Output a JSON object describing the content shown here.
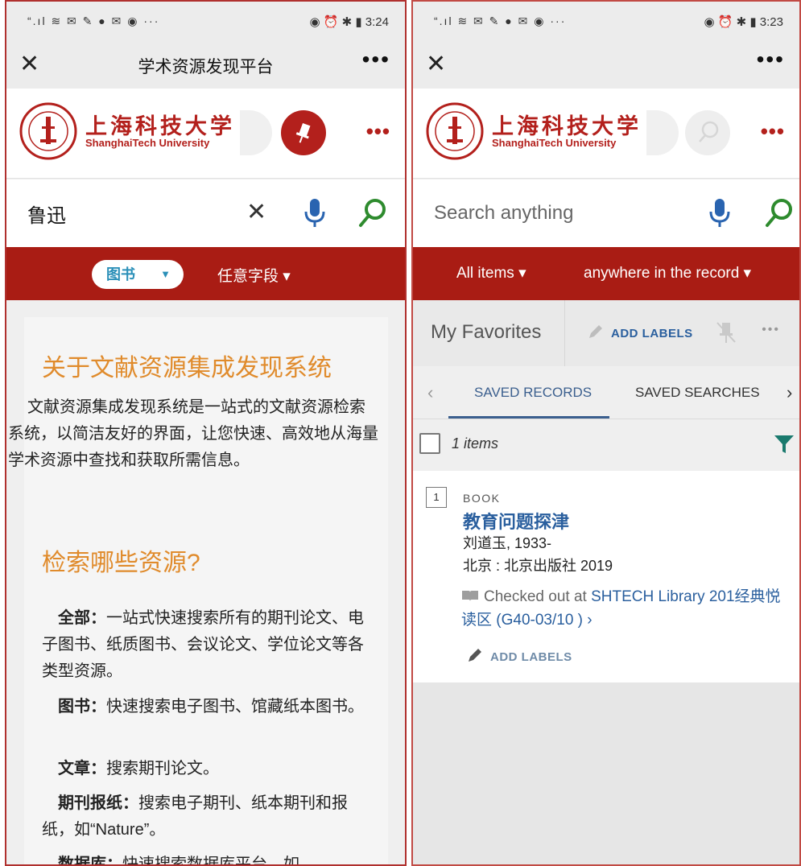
{
  "left": {
    "status": {
      "signal": "“.ıl ≋ ✉ ✎ ● ✉ ◉ ···",
      "time": "3:24"
    },
    "nav": {
      "title": "学术资源发现平台",
      "close": "✕",
      "more": "•••"
    },
    "brand": {
      "name_cn": "上海科技大学",
      "name_en": "ShanghaiTech University",
      "more": "•••"
    },
    "search": {
      "value": "鲁迅",
      "clear": "✕"
    },
    "filter": {
      "scope": "图书",
      "field": "任意字段 ▾"
    },
    "content": {
      "heading1": "关于文献资源集成发现系统",
      "intro": "文献资源集成发现系统是一站式的文献资源检索系统，以简洁友好的界面，让您快速、高效地从海量学术资源中查找和获取所需信息。",
      "heading2": "检索哪些资源?",
      "items": [
        {
          "term": "全部：",
          "desc": "一站式快速搜索所有的期刊论文、电子图书、纸质图书、会议论文、学位论文等各类型资源。"
        },
        {
          "term": "图书：",
          "desc": "快速搜索电子图书、馆藏纸本图书。"
        },
        {
          "term": "文章：",
          "desc": "搜索期刊论文。"
        },
        {
          "term": "期刊报纸：",
          "desc": "搜索电子期刊、纸本期刊和报纸，如“Nature”。"
        },
        {
          "term": "数据库：",
          "desc": "快速搜索数据库平台，如"
        }
      ]
    }
  },
  "right": {
    "status": {
      "signal": "“.ıl ≋ ✉ ✎ ● ✉ ◉ ···",
      "time": "3:23"
    },
    "nav": {
      "close": "✕",
      "more": "•••"
    },
    "brand": {
      "name_cn": "上海科技大学",
      "name_en": "ShanghaiTech University",
      "more": "•••"
    },
    "search": {
      "placeholder": "Search anything"
    },
    "filter": {
      "scope": "All items ▾",
      "field": "anywhere in the record ▾"
    },
    "favorites": {
      "title": "My Favorites",
      "add_labels": "ADD LABELS",
      "more": "•••"
    },
    "tabs": {
      "prev": "‹",
      "next": "›",
      "items": [
        "SAVED RECORDS",
        "SAVED SEARCHES"
      ]
    },
    "count": "1 items",
    "record": {
      "index": "1",
      "type": "BOOK",
      "title": "教育问题探津",
      "author": "刘道玉, 1933-",
      "publisher": "北京 : 北京出版社 2019",
      "avail_prefix": "Checked out at ",
      "avail_link": "SHTECH Library  201经典悦读区 (G40-03/10 )  ›",
      "add_labels": "ADD LABELS"
    }
  },
  "colors": {
    "brand_red": "#b3201c",
    "filter_bar": "#a91c14",
    "orange_heading": "#e08b2c",
    "link_blue": "#2a5f9e",
    "search_green": "#2e8b2e",
    "mic_blue": "#2a64b0",
    "filter_teal": "#1a7a6e"
  }
}
